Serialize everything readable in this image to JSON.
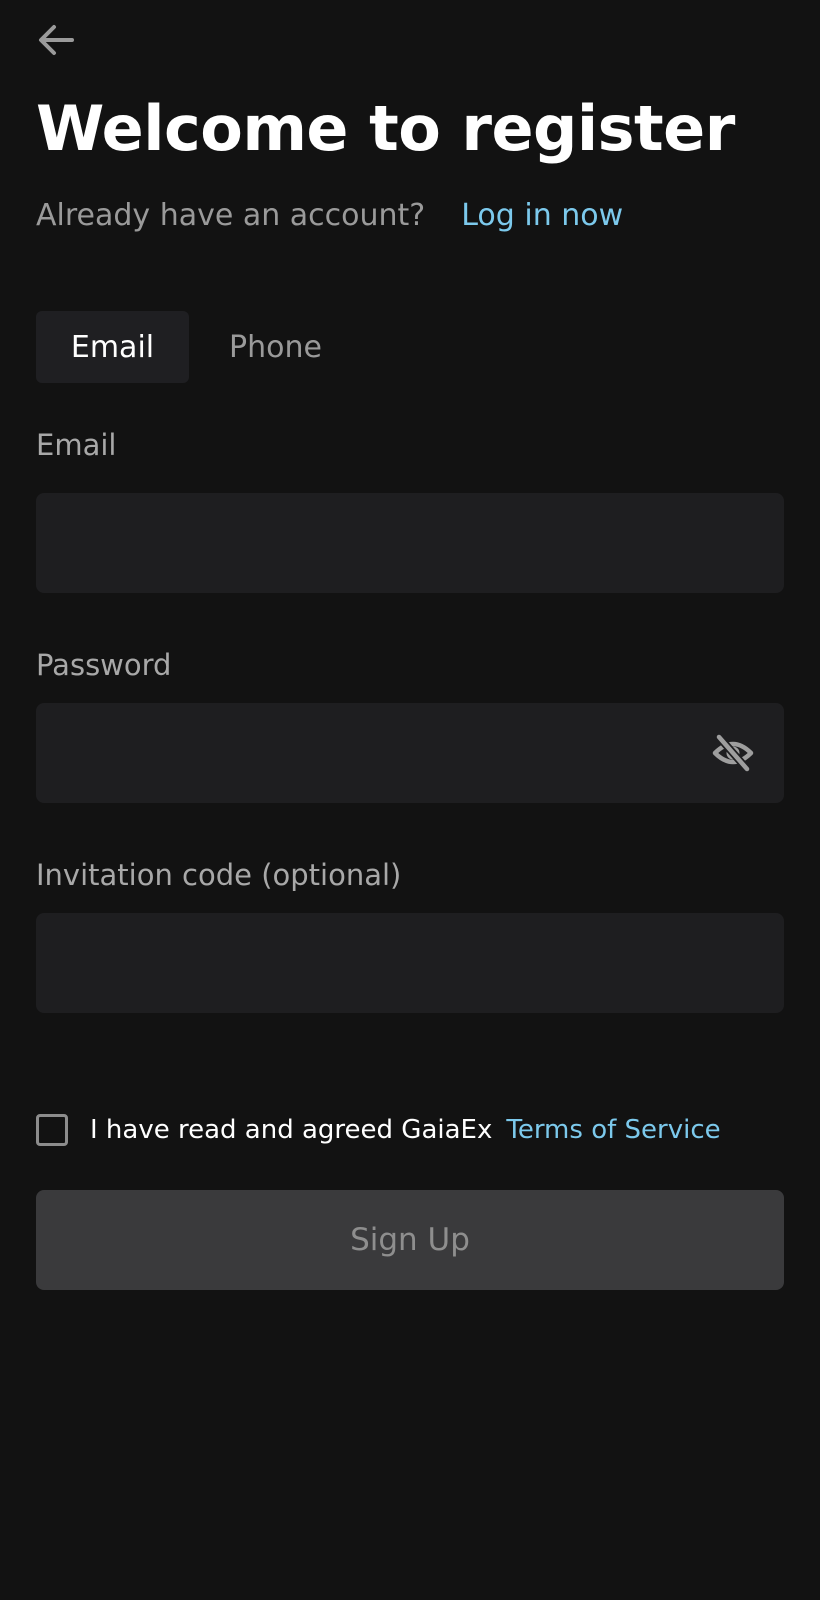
{
  "header": {
    "back_icon": "arrow-left-icon",
    "title": "Welcome to register"
  },
  "subtitle": {
    "text": "Already have an account?",
    "login_link": "Log in now"
  },
  "tabs": [
    {
      "label": "Email",
      "active": true
    },
    {
      "label": "Phone",
      "active": false
    }
  ],
  "fields": {
    "email": {
      "label": "Email",
      "value": "",
      "placeholder": ""
    },
    "password": {
      "label": "Password",
      "value": "",
      "placeholder": "",
      "toggle_icon": "eye-off-icon"
    },
    "invitation": {
      "label": "Invitation code (optional)",
      "value": "",
      "placeholder": ""
    }
  },
  "terms": {
    "checked": false,
    "text": "I have read and agreed GaiaEx",
    "link": "Terms of Service"
  },
  "signup_button": {
    "label": "Sign Up"
  },
  "colors": {
    "background": "#121212",
    "input_background": "#1e1e20",
    "link": "#7cc9ec",
    "button_disabled": "#3a3a3c"
  }
}
